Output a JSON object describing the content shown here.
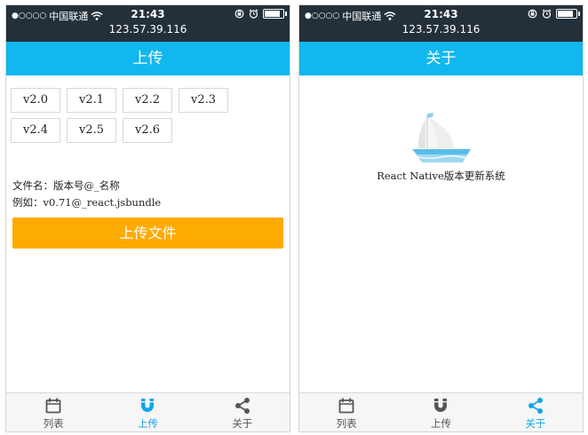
{
  "status_bar": {
    "signal_dots": "●○○○○",
    "carrier": "中国联通",
    "time": "21:43",
    "ip": "123.57.39.116",
    "battery_level": 0.85
  },
  "upload_screen": {
    "title": "上传",
    "versions": [
      "v2.0",
      "v2.1",
      "v2.2",
      "v2.3",
      "v2.4",
      "v2.5",
      "v2.6"
    ],
    "hint_format": "文件名：版本号@_名称",
    "hint_example": "例如：v0.71@_react.jsbundle",
    "upload_button": "上传文件"
  },
  "about_screen": {
    "title": "关于",
    "description": "React Native版本更新系统"
  },
  "tabs": [
    {
      "label": "列表",
      "icon": "calendar-icon"
    },
    {
      "label": "上传",
      "icon": "magnet-icon"
    },
    {
      "label": "关于",
      "icon": "share-icon"
    }
  ],
  "colors": {
    "status_bar": "#23303a",
    "nav_bar": "#11b7ef",
    "upload_button": "#fdab00",
    "tab_active": "#11a6e8",
    "tab_inactive": "#555555"
  }
}
